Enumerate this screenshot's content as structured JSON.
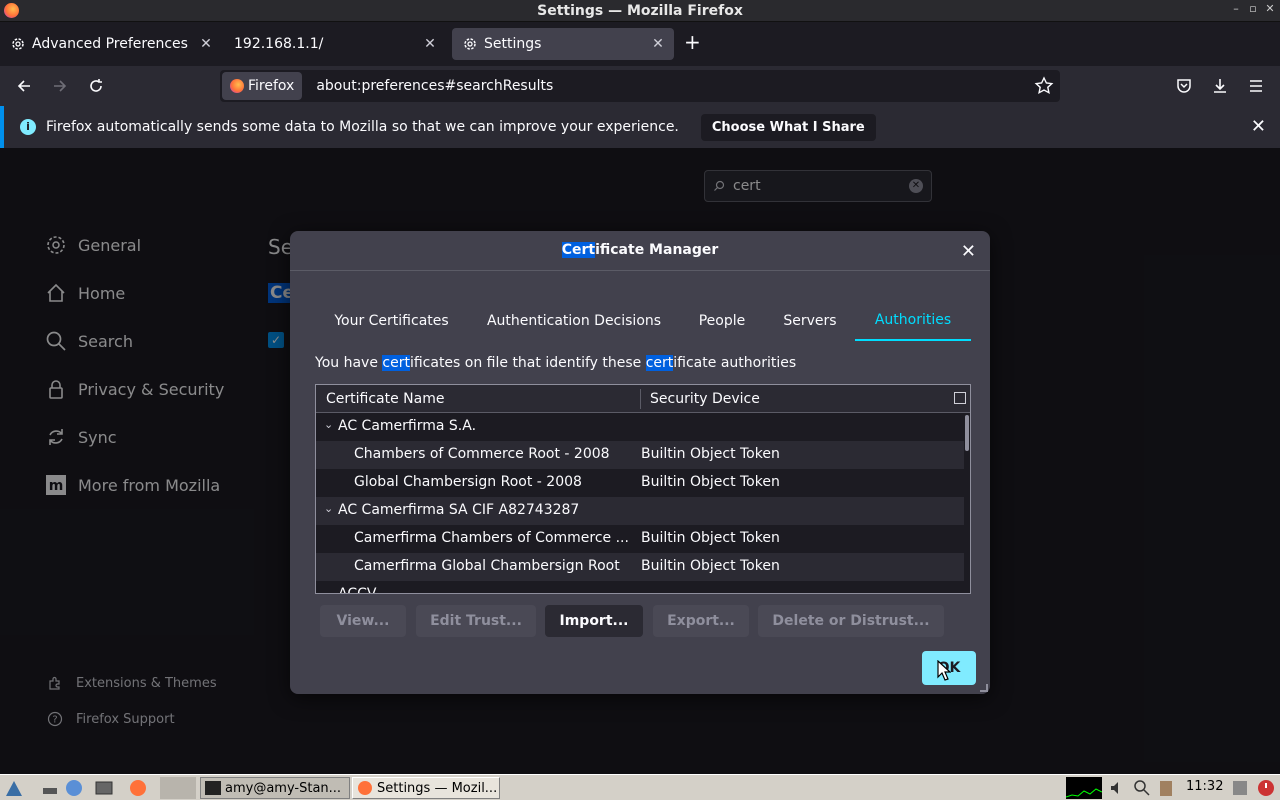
{
  "window": {
    "title": "Settings — Mozilla Firefox"
  },
  "tabs": [
    {
      "label": "Advanced Preferences"
    },
    {
      "label": "192.168.1.1/"
    },
    {
      "label": "Settings"
    }
  ],
  "urlbar": {
    "identity": "Firefox",
    "url": "about:preferences#searchResults"
  },
  "notification": {
    "message": "Firefox automatically sends some data to Mozilla so that we can improve your experience.",
    "button": "Choose What I Share"
  },
  "prefs": {
    "search_value": "cert",
    "sidebar": [
      {
        "label": "General",
        "icon": "gear-icon"
      },
      {
        "label": "Home",
        "icon": "home-icon"
      },
      {
        "label": "Search",
        "icon": "search-icon"
      },
      {
        "label": "Privacy & Security",
        "icon": "lock-icon"
      },
      {
        "label": "Sync",
        "icon": "sync-icon"
      },
      {
        "label": "More from Mozilla",
        "icon": "mozilla-icon"
      }
    ],
    "footer": [
      {
        "label": "Extensions & Themes",
        "icon": "puzzle-icon"
      },
      {
        "label": "Firefox Support",
        "icon": "help-icon"
      }
    ],
    "fragments": {
      "a": "Se",
      "b": "Ce"
    }
  },
  "dialog": {
    "title_hl": "Cert",
    "title_rest": "ificate Manager",
    "tabs": [
      "Your Certificates",
      "Authentication Decisions",
      "People",
      "Servers",
      "Authorities"
    ],
    "active_tab": "Authorities",
    "intro": {
      "p1": "You have ",
      "h1": "cert",
      "p2": "ificates on file that identify these ",
      "h2": "cert",
      "p3": "ificate authorities"
    },
    "columns": {
      "name": "Certificate Name",
      "device": "Security Device"
    },
    "rows": [
      {
        "name": "AC Camerfirma S.A.",
        "device": "",
        "group": true
      },
      {
        "name": "Chambers of Commerce Root - 2008",
        "device": "Builtin Object Token",
        "group": false
      },
      {
        "name": "Global Chambersign Root - 2008",
        "device": "Builtin Object Token",
        "group": false
      },
      {
        "name": "AC Camerfirma SA CIF A82743287",
        "device": "",
        "group": true
      },
      {
        "name": "Camerfirma Chambers of Commerce ...",
        "device": "Builtin Object Token",
        "group": false
      },
      {
        "name": "Camerfirma Global Chambersign Root",
        "device": "Builtin Object Token",
        "group": false
      },
      {
        "name": "ACCV",
        "device": "",
        "group": true
      }
    ],
    "buttons": {
      "view": "View...",
      "edit": "Edit Trust...",
      "import": "Import...",
      "export": "Export...",
      "delete": "Delete or Distrust..."
    },
    "ok": "OK"
  },
  "taskbar": {
    "tasks": [
      "amy@amy-Stan...",
      "Settings — Mozil..."
    ],
    "clock": "11:32"
  },
  "colors": {
    "accent": "#00ddff",
    "highlight": "#0060df",
    "ok": "#80ebff"
  }
}
